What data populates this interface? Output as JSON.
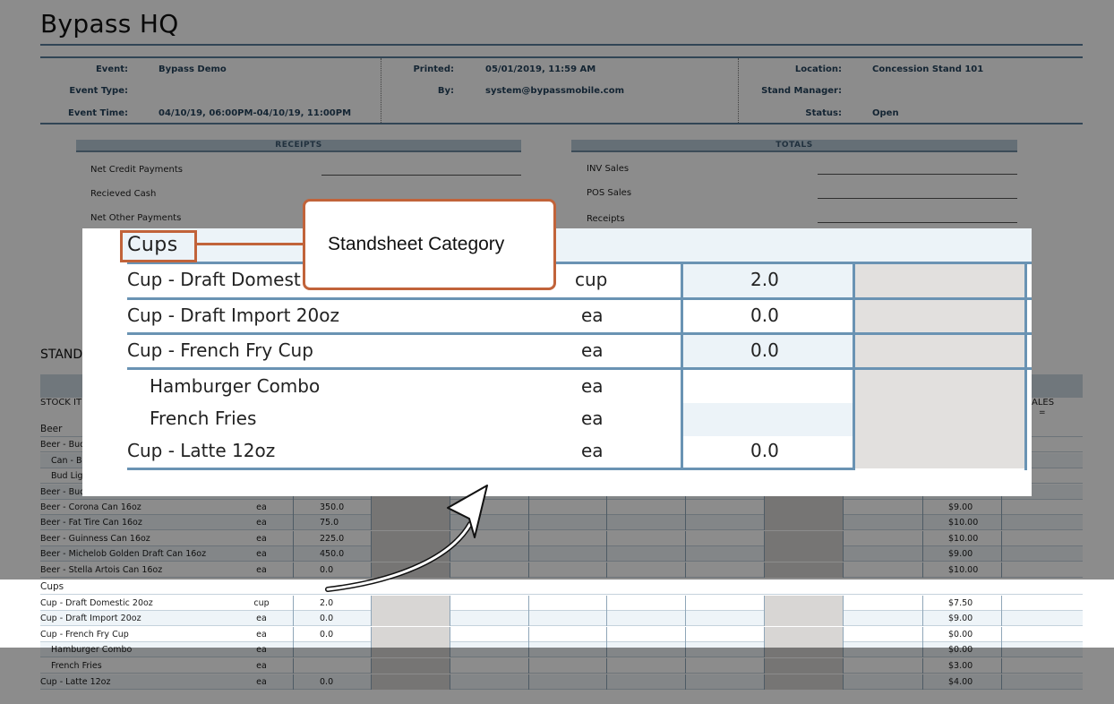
{
  "document": {
    "title": "Bypass HQ",
    "meta": {
      "event_label": "Event:",
      "event_value": "Bypass Demo",
      "event_type_label": "Event Type:",
      "event_type_value": "",
      "event_time_label": "Event Time:",
      "event_time_value": "04/10/19, 06:00PM-04/10/19, 11:00PM",
      "printed_label": "Printed:",
      "printed_value": "05/01/2019, 11:59 AM",
      "by_label": "By:",
      "by_value": "system@bypassmobile.com",
      "location_label": "Location:",
      "location_value": "Concession Stand 101",
      "stand_manager_label": "Stand Manager:",
      "stand_manager_value": "",
      "status_label": "Status:",
      "status_value": "Open"
    },
    "receipts": {
      "heading": "RECEIPTS",
      "rows": [
        "Net Credit Payments",
        "Recieved Cash",
        "Net Other Payments"
      ]
    },
    "totals": {
      "heading": "TOTALS",
      "rows": [
        "INV Sales",
        "POS Sales",
        "Receipts"
      ]
    },
    "section_title": "STAND",
    "column_headers": {
      "stock_item": "STOCK IT",
      "sales": "ALES",
      "sales_sub": "="
    },
    "beer_rows": [
      {
        "name": "Beer",
        "type": "category"
      },
      {
        "name": "Beer - Bud",
        "type": "item",
        "unit": "",
        "qty": "",
        "price": ""
      },
      {
        "name": "Can - Bu",
        "type": "sub",
        "unit": "",
        "qty": "",
        "price": ""
      },
      {
        "name": "Bud Ligh",
        "type": "sub",
        "unit": "",
        "qty": "",
        "price": ""
      },
      {
        "name": "Beer - Bud",
        "type": "item",
        "unit": "",
        "qty": "",
        "price": ""
      },
      {
        "name": "Beer - Corona Can 16oz",
        "type": "item",
        "unit": "ea",
        "qty": "350.0",
        "price": "$9.00"
      },
      {
        "name": "Beer - Fat Tire Can 16oz",
        "type": "item",
        "unit": "ea",
        "qty": "75.0",
        "price": "$10.00"
      },
      {
        "name": "Beer - Guinness Can 16oz",
        "type": "item",
        "unit": "ea",
        "qty": "225.0",
        "price": "$10.00"
      },
      {
        "name": "Beer - Michelob Golden Draft Can 16oz",
        "type": "item",
        "unit": "ea",
        "qty": "450.0",
        "price": "$9.00"
      },
      {
        "name": "Beer - Stella Artois Can 16oz",
        "type": "item",
        "unit": "ea",
        "qty": "0.0",
        "price": "$10.00"
      }
    ],
    "cups_rows": [
      {
        "name": "Cups",
        "type": "category"
      },
      {
        "name": "Cup - Draft Domestic 20oz",
        "type": "item",
        "unit": "cup",
        "qty": "2.0",
        "price": "$7.50"
      },
      {
        "name": "Cup - Draft Import 20oz",
        "type": "item",
        "unit": "ea",
        "qty": "0.0",
        "price": "$9.00"
      },
      {
        "name": "Cup - French Fry Cup",
        "type": "item",
        "unit": "ea",
        "qty": "0.0",
        "price": "$0.00"
      },
      {
        "name": "Hamburger Combo",
        "type": "sub",
        "unit": "ea",
        "qty": "",
        "price": "$0.00"
      },
      {
        "name": "French Fries",
        "type": "sub",
        "unit": "ea",
        "qty": "",
        "price": "$3.00"
      },
      {
        "name": "Cup - Latte 12oz",
        "type": "item",
        "unit": "ea",
        "qty": "0.0",
        "price": "$4.00"
      }
    ]
  },
  "zoom": {
    "category": "Cups",
    "rows": [
      {
        "name": "Cup - Draft Domest",
        "unit": "cup",
        "qty": "2.0"
      },
      {
        "name": "Cup - Draft Import 20oz",
        "unit": "ea",
        "qty": "0.0"
      },
      {
        "name": "Cup - French Fry Cup",
        "unit": "ea",
        "qty": "0.0"
      },
      {
        "name": "Hamburger Combo",
        "unit": "ea",
        "qty": ""
      },
      {
        "name": "French Fries",
        "unit": "ea",
        "qty": ""
      },
      {
        "name": "Cup - Latte 12oz",
        "unit": "ea",
        "qty": "0.0"
      }
    ]
  },
  "callout": {
    "text": "Standsheet Category"
  },
  "colors": {
    "accent": "#c1633a",
    "rule": "#5a7f9c",
    "dim": "rgba(0,0,0,0.45)"
  }
}
